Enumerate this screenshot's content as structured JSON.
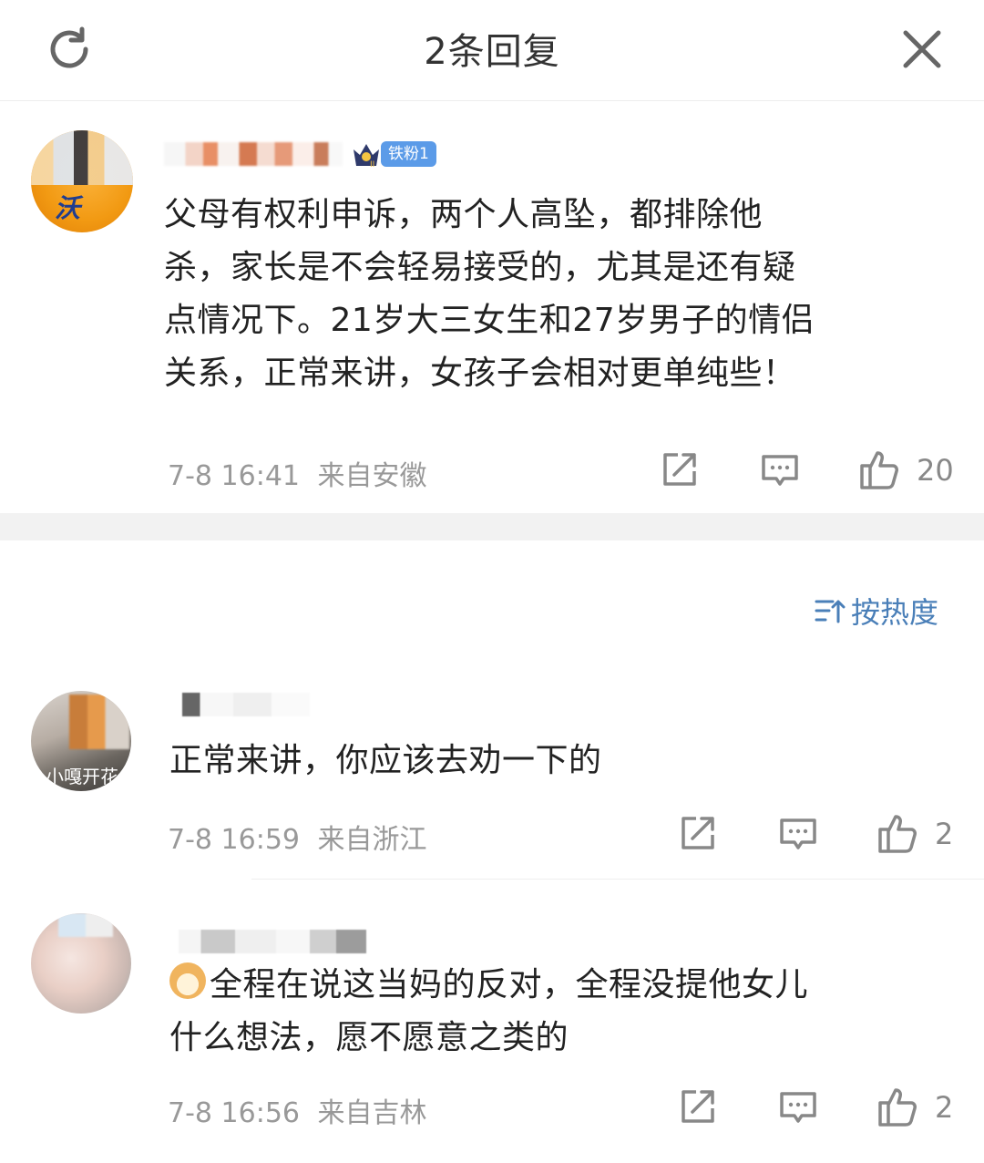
{
  "header": {
    "title": "2条回复"
  },
  "main_comment": {
    "fan_badge": "铁粉1",
    "text": "父母有权利申诉，两个人高坠，都排除他\n杀，家长是不会轻易接受的，尤其是还有疑\n点情况下。21岁大三女生和27岁男子的情侣\n关系，正常来讲，女孩子会相对更单纯些！",
    "time": "7-8 16:41",
    "location": "来自安徽",
    "likes": "20",
    "avatar_text": "沃"
  },
  "sort": {
    "label": "按热度"
  },
  "replies": [
    {
      "avatar_text": "小嘎开花",
      "text": "正常来讲，你应该去劝一下的",
      "time": "7-8 16:59",
      "location": "来自浙江",
      "likes": "2"
    },
    {
      "emoji": "doge",
      "text": "全程在说这当妈的反对，全程没提他女儿\n什么想法，愿不愿意之类的",
      "time": "7-8 16:56",
      "location": "来自吉林",
      "likes": "2"
    }
  ],
  "icons": {
    "refresh": "refresh-icon",
    "close": "close-icon",
    "share": "share-icon",
    "comment": "comment-icon",
    "like": "thumbs-up-icon",
    "sort": "sort-icon"
  },
  "colors": {
    "accent_blue": "#4a7fb8",
    "badge_blue": "#5b9be8",
    "verified_orange": "#f38b0a",
    "meta_gray": "#999999"
  }
}
